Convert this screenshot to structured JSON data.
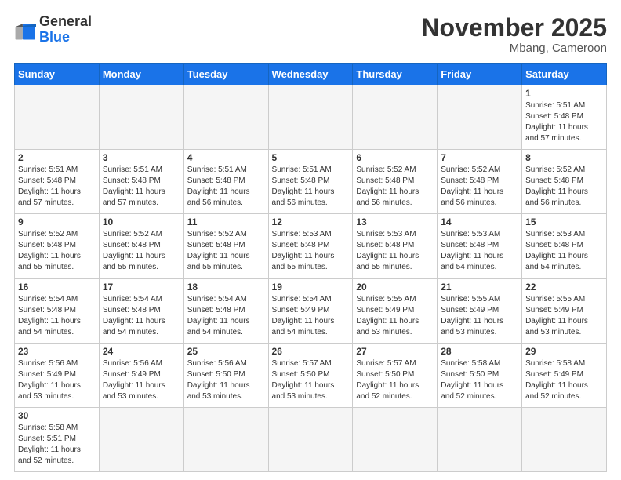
{
  "header": {
    "logo_general": "General",
    "logo_blue": "Blue",
    "month_title": "November 2025",
    "location": "Mbang, Cameroon"
  },
  "weekdays": [
    "Sunday",
    "Monday",
    "Tuesday",
    "Wednesday",
    "Thursday",
    "Friday",
    "Saturday"
  ],
  "weeks": [
    [
      {
        "day": "",
        "empty": true
      },
      {
        "day": "",
        "empty": true
      },
      {
        "day": "",
        "empty": true
      },
      {
        "day": "",
        "empty": true
      },
      {
        "day": "",
        "empty": true
      },
      {
        "day": "",
        "empty": true
      },
      {
        "day": "1",
        "sunrise": "5:51 AM",
        "sunset": "5:48 PM",
        "daylight": "11 hours and 57 minutes."
      }
    ],
    [
      {
        "day": "2",
        "sunrise": "5:51 AM",
        "sunset": "5:48 PM",
        "daylight": "11 hours and 57 minutes."
      },
      {
        "day": "3",
        "sunrise": "5:51 AM",
        "sunset": "5:48 PM",
        "daylight": "11 hours and 57 minutes."
      },
      {
        "day": "4",
        "sunrise": "5:51 AM",
        "sunset": "5:48 PM",
        "daylight": "11 hours and 56 minutes."
      },
      {
        "day": "5",
        "sunrise": "5:51 AM",
        "sunset": "5:48 PM",
        "daylight": "11 hours and 56 minutes."
      },
      {
        "day": "6",
        "sunrise": "5:52 AM",
        "sunset": "5:48 PM",
        "daylight": "11 hours and 56 minutes."
      },
      {
        "day": "7",
        "sunrise": "5:52 AM",
        "sunset": "5:48 PM",
        "daylight": "11 hours and 56 minutes."
      },
      {
        "day": "8",
        "sunrise": "5:52 AM",
        "sunset": "5:48 PM",
        "daylight": "11 hours and 56 minutes."
      }
    ],
    [
      {
        "day": "9",
        "sunrise": "5:52 AM",
        "sunset": "5:48 PM",
        "daylight": "11 hours and 55 minutes."
      },
      {
        "day": "10",
        "sunrise": "5:52 AM",
        "sunset": "5:48 PM",
        "daylight": "11 hours and 55 minutes."
      },
      {
        "day": "11",
        "sunrise": "5:52 AM",
        "sunset": "5:48 PM",
        "daylight": "11 hours and 55 minutes."
      },
      {
        "day": "12",
        "sunrise": "5:53 AM",
        "sunset": "5:48 PM",
        "daylight": "11 hours and 55 minutes."
      },
      {
        "day": "13",
        "sunrise": "5:53 AM",
        "sunset": "5:48 PM",
        "daylight": "11 hours and 55 minutes."
      },
      {
        "day": "14",
        "sunrise": "5:53 AM",
        "sunset": "5:48 PM",
        "daylight": "11 hours and 54 minutes."
      },
      {
        "day": "15",
        "sunrise": "5:53 AM",
        "sunset": "5:48 PM",
        "daylight": "11 hours and 54 minutes."
      }
    ],
    [
      {
        "day": "16",
        "sunrise": "5:54 AM",
        "sunset": "5:48 PM",
        "daylight": "11 hours and 54 minutes."
      },
      {
        "day": "17",
        "sunrise": "5:54 AM",
        "sunset": "5:48 PM",
        "daylight": "11 hours and 54 minutes."
      },
      {
        "day": "18",
        "sunrise": "5:54 AM",
        "sunset": "5:48 PM",
        "daylight": "11 hours and 54 minutes."
      },
      {
        "day": "19",
        "sunrise": "5:54 AM",
        "sunset": "5:49 PM",
        "daylight": "11 hours and 54 minutes."
      },
      {
        "day": "20",
        "sunrise": "5:55 AM",
        "sunset": "5:49 PM",
        "daylight": "11 hours and 53 minutes."
      },
      {
        "day": "21",
        "sunrise": "5:55 AM",
        "sunset": "5:49 PM",
        "daylight": "11 hours and 53 minutes."
      },
      {
        "day": "22",
        "sunrise": "5:55 AM",
        "sunset": "5:49 PM",
        "daylight": "11 hours and 53 minutes."
      }
    ],
    [
      {
        "day": "23",
        "sunrise": "5:56 AM",
        "sunset": "5:49 PM",
        "daylight": "11 hours and 53 minutes."
      },
      {
        "day": "24",
        "sunrise": "5:56 AM",
        "sunset": "5:49 PM",
        "daylight": "11 hours and 53 minutes."
      },
      {
        "day": "25",
        "sunrise": "5:56 AM",
        "sunset": "5:50 PM",
        "daylight": "11 hours and 53 minutes."
      },
      {
        "day": "26",
        "sunrise": "5:57 AM",
        "sunset": "5:50 PM",
        "daylight": "11 hours and 53 minutes."
      },
      {
        "day": "27",
        "sunrise": "5:57 AM",
        "sunset": "5:50 PM",
        "daylight": "11 hours and 52 minutes."
      },
      {
        "day": "28",
        "sunrise": "5:58 AM",
        "sunset": "5:50 PM",
        "daylight": "11 hours and 52 minutes."
      },
      {
        "day": "29",
        "sunrise": "5:58 AM",
        "sunset": "5:49 PM",
        "daylight": "11 hours and 52 minutes."
      }
    ],
    [
      {
        "day": "30",
        "sunrise": "5:58 AM",
        "sunset": "5:51 PM",
        "daylight": "11 hours and 52 minutes."
      },
      {
        "day": "",
        "empty": true
      },
      {
        "day": "",
        "empty": true
      },
      {
        "day": "",
        "empty": true
      },
      {
        "day": "",
        "empty": true
      },
      {
        "day": "",
        "empty": true
      },
      {
        "day": "",
        "empty": true
      }
    ]
  ],
  "labels": {
    "sunrise_prefix": "Sunrise: ",
    "sunset_prefix": "Sunset: ",
    "daylight_prefix": "Daylight: "
  }
}
